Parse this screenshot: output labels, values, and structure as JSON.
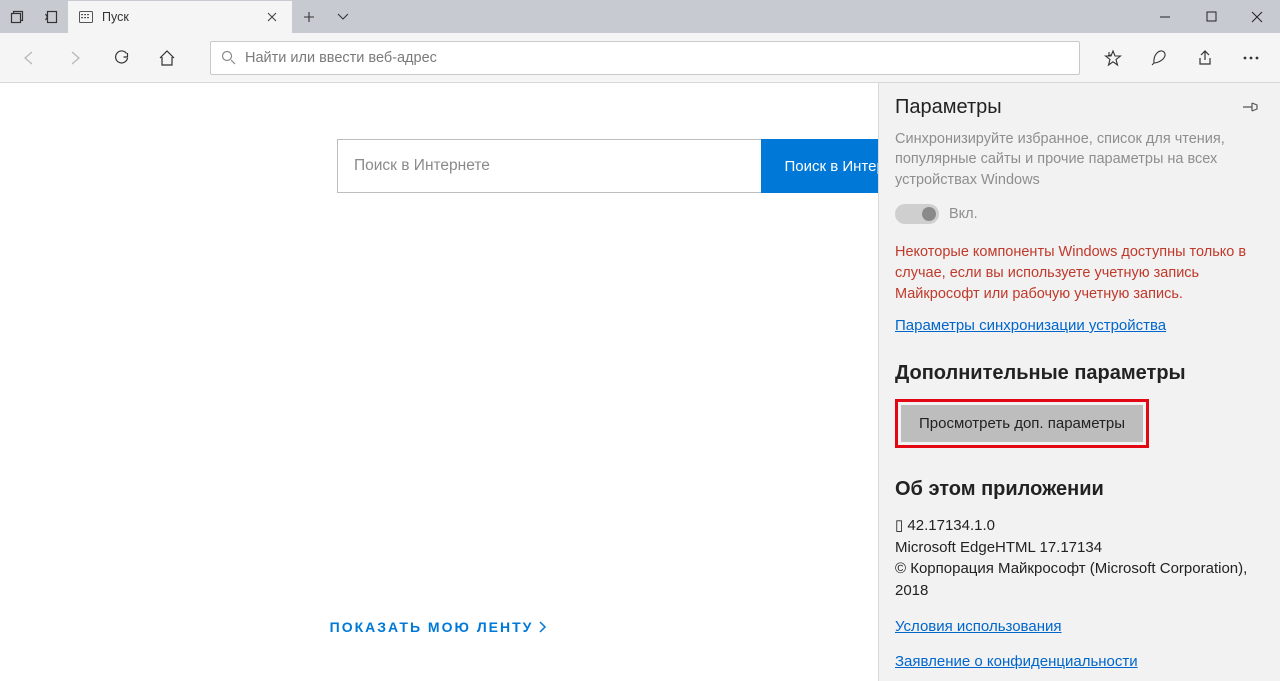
{
  "titlebar": {
    "tab_title": "Пуск"
  },
  "toolbar": {
    "address_placeholder": "Найти или ввести веб-адрес"
  },
  "start": {
    "search_placeholder": "Поиск в Интернете",
    "search_button": "Поиск в Интернете",
    "feed_link": "ПОКАЗАТЬ МОЮ ЛЕНТУ"
  },
  "panel": {
    "title": "Параметры",
    "sync_desc": "Синхронизируйте избранное, список для чтения, популярные сайты и прочие параметры на всех устройствах Windows",
    "toggle_label": "Вкл.",
    "warning": "Некоторые компоненты Windows доступны только в случае, если вы используете учетную запись Майкрософт или рабочую учетную запись.",
    "sync_link": "Параметры синхронизации устройства",
    "advanced_heading": "Дополнительные параметры",
    "advanced_button": "Просмотреть доп. параметры",
    "about_heading": "Об этом приложении",
    "about_line1": "▯ 42.17134.1.0",
    "about_line2": "Microsoft EdgeHTML 17.17134",
    "about_line3": "© Корпорация Майкрософт (Microsoft Corporation), 2018",
    "terms_link": "Условия использования",
    "privacy_link": "Заявление о конфиденциальности"
  }
}
